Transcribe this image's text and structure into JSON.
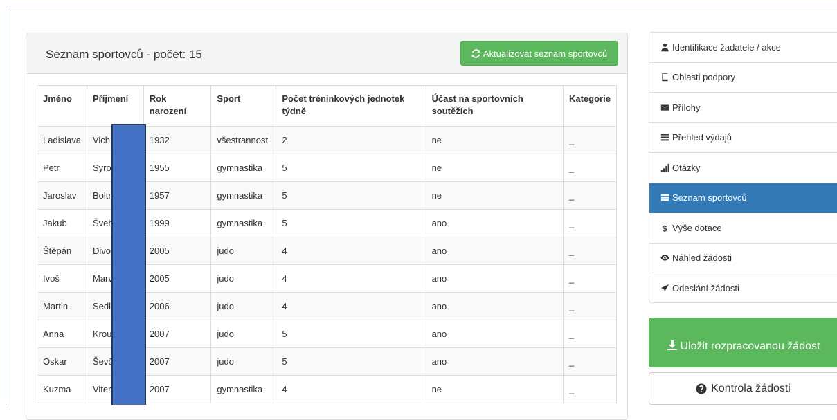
{
  "panel": {
    "title": "Seznam sportovců - počet: 15",
    "refresh_button": "Aktualizovat seznam sportovců"
  },
  "table": {
    "headers": {
      "first_name": "Jméno",
      "last_name": "Příjmení",
      "birth_year": "Rok narození",
      "sport": "Sport",
      "trainings": "Počet tréninkových jednotek týdně",
      "competitions": "Účast na sportovních soutěžích",
      "category": "Kategorie"
    },
    "rows": [
      {
        "first": "Ladislava",
        "last": "Vich",
        "year": "1932",
        "sport": "všestrannost",
        "trainings": "2",
        "competitions": "ne",
        "category": "_"
      },
      {
        "first": "Petr",
        "last": "Syro",
        "year": "1955",
        "sport": "gymnastika",
        "trainings": "5",
        "competitions": "ne",
        "category": "_"
      },
      {
        "first": "Jaroslav",
        "last": "Boltr",
        "year": "1957",
        "sport": "gymnastika",
        "trainings": "5",
        "competitions": "ne",
        "category": "_"
      },
      {
        "first": "Jakub",
        "last": "Šveh",
        "year": "1999",
        "sport": "gymnastika",
        "trainings": "5",
        "competitions": "ano",
        "category": "_"
      },
      {
        "first": "Štěpán",
        "last": "Divo",
        "year": "2005",
        "sport": "judo",
        "trainings": "4",
        "competitions": "ano",
        "category": "_"
      },
      {
        "first": "Ivoš",
        "last": "Marv",
        "year": "2005",
        "sport": "judo",
        "trainings": "4",
        "competitions": "ano",
        "category": "_"
      },
      {
        "first": "Martin",
        "last": "Sedl",
        "year": "2006",
        "sport": "judo",
        "trainings": "4",
        "competitions": "ano",
        "category": "_"
      },
      {
        "first": "Anna",
        "last": "Krou",
        "year": "2007",
        "sport": "judo",
        "trainings": "5",
        "competitions": "ano",
        "category": "_"
      },
      {
        "first": "Oskar",
        "last": "Ševč",
        "year": "2007",
        "sport": "judo",
        "trainings": "5",
        "competitions": "ano",
        "category": "_"
      },
      {
        "first": "Kuzma",
        "last": "Viter",
        "year": "2007",
        "sport": "gymnastika",
        "trainings": "4",
        "competitions": "ne",
        "category": "_"
      }
    ]
  },
  "nav": {
    "items": [
      {
        "label": "Identifikace žadatele / akce",
        "icon": "user-icon"
      },
      {
        "label": "Oblasti podpory",
        "icon": "book-icon"
      },
      {
        "label": "Přílohy",
        "icon": "envelope-icon"
      },
      {
        "label": "Přehled výdajů",
        "icon": "list-icon"
      },
      {
        "label": "Otázky",
        "icon": "signal-icon"
      },
      {
        "label": "Seznam sportovců",
        "icon": "th-list-icon"
      },
      {
        "label": "Výše dotace",
        "icon": "dollar-icon"
      },
      {
        "label": "Náhled žádosti",
        "icon": "eye-icon"
      },
      {
        "label": "Odeslání žádosti",
        "icon": "send-icon"
      }
    ],
    "active_index": 5
  },
  "actions": {
    "save": "Uložit rozpracovanou žádost",
    "check": "Kontrola žádosti"
  },
  "colors": {
    "primary": "#337ab7",
    "success": "#5cb85c",
    "redaction": "#4472c4"
  }
}
